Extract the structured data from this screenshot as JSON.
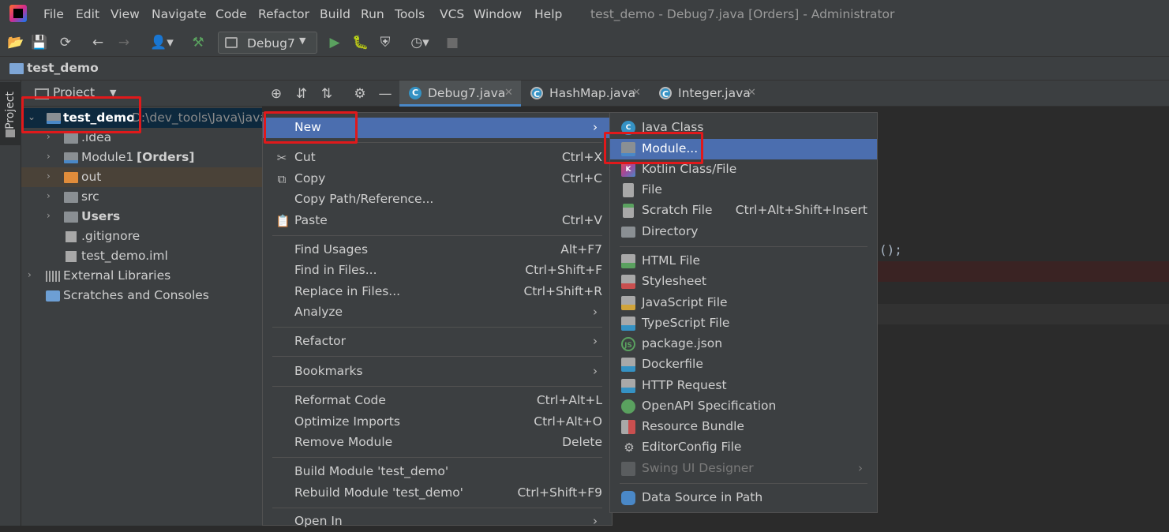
{
  "menubar": {
    "items": [
      "File",
      "Edit",
      "View",
      "Navigate",
      "Code",
      "Refactor",
      "Build",
      "Run",
      "Tools",
      "VCS",
      "Window",
      "Help"
    ],
    "window_title": "test_demo - Debug7.java [Orders] - Administrator"
  },
  "toolbar": {
    "run_config": "Debug7"
  },
  "breadcrumb": {
    "project": "test_demo"
  },
  "side_stripe": {
    "label": "Project"
  },
  "project_panel": {
    "header": "Project",
    "tree": [
      {
        "label": "test_demo",
        "path": "D:\\dev_tools\\Java\\javac"
      },
      {
        "label": ".idea"
      },
      {
        "label": "Module1",
        "tag": "[Orders]"
      },
      {
        "label": "out"
      },
      {
        "label": "src"
      },
      {
        "label": "Users"
      },
      {
        "label": ".gitignore"
      },
      {
        "label": "test_demo.iml"
      },
      {
        "label": "External Libraries"
      },
      {
        "label": "Scratches and Consoles"
      }
    ]
  },
  "editor": {
    "tabs": [
      "Debug7.java",
      "HashMap.java",
      "Integer.java"
    ],
    "code_fragment": "();"
  },
  "context_menu": {
    "items": [
      {
        "label": "New",
        "shortcut": ""
      },
      {
        "label": "Cut",
        "shortcut": "Ctrl+X"
      },
      {
        "label": "Copy",
        "shortcut": "Ctrl+C"
      },
      {
        "label": "Copy Path/Reference...",
        "shortcut": ""
      },
      {
        "label": "Paste",
        "shortcut": "Ctrl+V"
      },
      {
        "label": "Find Usages",
        "shortcut": "Alt+F7"
      },
      {
        "label": "Find in Files...",
        "shortcut": "Ctrl+Shift+F"
      },
      {
        "label": "Replace in Files...",
        "shortcut": "Ctrl+Shift+R"
      },
      {
        "label": "Analyze",
        "shortcut": ""
      },
      {
        "label": "Refactor",
        "shortcut": ""
      },
      {
        "label": "Bookmarks",
        "shortcut": ""
      },
      {
        "label": "Reformat Code",
        "shortcut": "Ctrl+Alt+L"
      },
      {
        "label": "Optimize Imports",
        "shortcut": "Ctrl+Alt+O"
      },
      {
        "label": "Remove Module",
        "shortcut": "Delete"
      },
      {
        "label": "Build Module 'test_demo'",
        "shortcut": ""
      },
      {
        "label": "Rebuild Module 'test_demo'",
        "shortcut": "Ctrl+Shift+F9"
      },
      {
        "label": "Open In",
        "shortcut": ""
      }
    ]
  },
  "submenu": {
    "items": [
      {
        "label": "Java Class",
        "shortcut": ""
      },
      {
        "label": "Module...",
        "shortcut": ""
      },
      {
        "label": "Kotlin Class/File",
        "shortcut": ""
      },
      {
        "label": "File",
        "shortcut": ""
      },
      {
        "label": "Scratch File",
        "shortcut": "Ctrl+Alt+Shift+Insert"
      },
      {
        "label": "Directory",
        "shortcut": ""
      },
      {
        "label": "HTML File",
        "shortcut": ""
      },
      {
        "label": "Stylesheet",
        "shortcut": ""
      },
      {
        "label": "JavaScript File",
        "shortcut": ""
      },
      {
        "label": "TypeScript File",
        "shortcut": ""
      },
      {
        "label": "package.json",
        "shortcut": ""
      },
      {
        "label": "Dockerfile",
        "shortcut": ""
      },
      {
        "label": "HTTP Request",
        "shortcut": ""
      },
      {
        "label": "OpenAPI Specification",
        "shortcut": ""
      },
      {
        "label": "Resource Bundle",
        "shortcut": ""
      },
      {
        "label": "EditorConfig File",
        "shortcut": ""
      },
      {
        "label": "Swing UI Designer",
        "shortcut": ""
      },
      {
        "label": "Data Source in Path",
        "shortcut": ""
      }
    ]
  },
  "colors": {
    "selection": "#4b6eaf",
    "highlight_box": "#e0191b",
    "panel_bg": "#3c3f41",
    "editor_bg": "#2b2b2b"
  }
}
